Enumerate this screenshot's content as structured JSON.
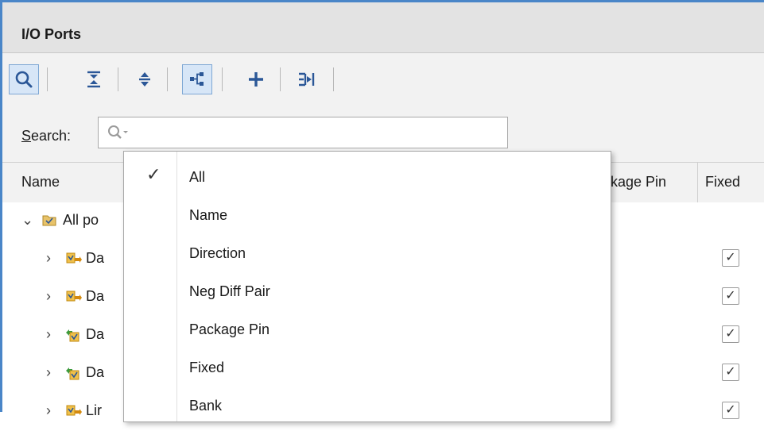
{
  "panel": {
    "title": "I/O Ports"
  },
  "toolbar": {
    "buttons": [
      {
        "icon": "search-icon",
        "active": true
      },
      {
        "icon": "collapse-all-icon",
        "active": false
      },
      {
        "icon": "expand-all-icon",
        "active": false
      },
      {
        "icon": "group-by-interface-icon",
        "active": true
      },
      {
        "icon": "add-icon",
        "active": false
      },
      {
        "icon": "schedule-icon",
        "active": false
      }
    ]
  },
  "search": {
    "label_prefix": "S",
    "label_rest": "earch:",
    "value": "",
    "placeholder": ""
  },
  "table": {
    "columns": {
      "name": "Name",
      "package_pin": "kage Pin",
      "fixed": "Fixed"
    },
    "rows": [
      {
        "label": "All po",
        "expanded": true,
        "icon": "folder-icon",
        "fixed": false
      },
      {
        "label": "Da",
        "expanded": false,
        "icon": "bus-port-icon",
        "fixed": true
      },
      {
        "label": "Da",
        "expanded": false,
        "icon": "bus-port-icon",
        "fixed": true
      },
      {
        "label": "Da",
        "expanded": false,
        "icon": "interface-port-icon",
        "fixed": true
      },
      {
        "label": "Da",
        "expanded": false,
        "icon": "interface-port-icon",
        "fixed": true
      },
      {
        "label": "Lir",
        "expanded": false,
        "icon": "bus-port-icon",
        "fixed": true
      }
    ]
  },
  "dropdown": {
    "items": [
      {
        "label": "All",
        "checked": true
      },
      {
        "label": "Name",
        "checked": false
      },
      {
        "label": "Direction",
        "checked": false
      },
      {
        "label": "Neg Diff Pair",
        "checked": false
      },
      {
        "label": "Package Pin",
        "checked": false
      },
      {
        "label": "Fixed",
        "checked": false
      },
      {
        "label": "Bank",
        "checked": false
      }
    ]
  },
  "glyphs": {
    "check": "✓",
    "chevron_down": "⌄",
    "chevron_right": "›"
  },
  "colors": {
    "accent": "#4a86c8",
    "icon_blue": "#2b5797",
    "icon_orange": "#d48a0e",
    "icon_green": "#3c9a3c"
  }
}
